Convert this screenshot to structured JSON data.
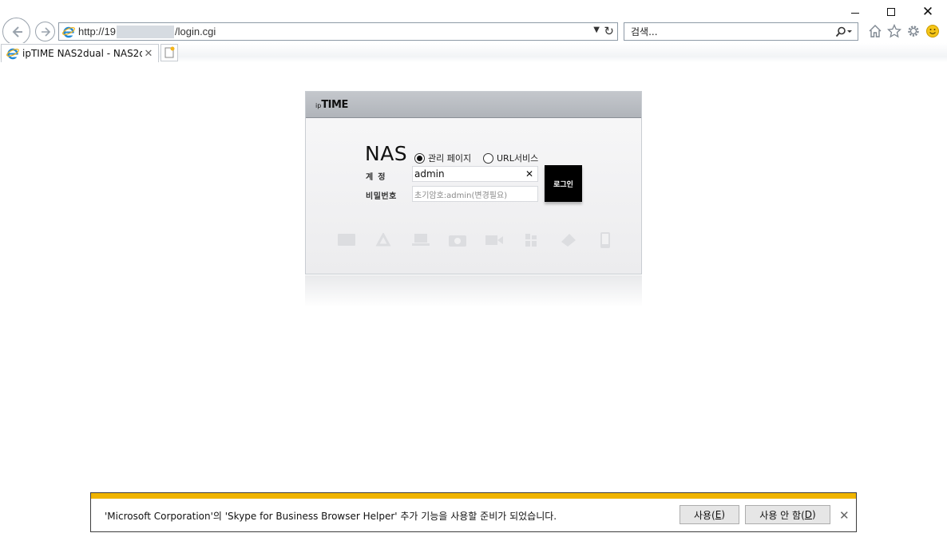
{
  "browser": {
    "address_prefix": "http://19",
    "address_suffix": "/login.cgi",
    "search_placeholder": "검색...",
    "tab_title": "ipTIME NAS2dual - NAS2d...",
    "window_controls": {
      "minimize": "minimize-icon",
      "maximize": "maximize-icon",
      "close": "close-icon"
    },
    "toolbar_icons": [
      "home-icon",
      "star-icon",
      "gear-icon",
      "smile-icon"
    ]
  },
  "login": {
    "brand_prefix": "ip",
    "brand_name": "TIME",
    "title": "NAS",
    "radio_admin": "관리 페이지",
    "radio_url": "URL서비스",
    "selected_mode": "관리 페이지",
    "label_account": "계정",
    "label_password": "비밀번호",
    "account_value": "admin",
    "password_placeholder": "초기암호:admin(변경필요)",
    "login_button": "로그인",
    "feature_icons": [
      "monitor-icon",
      "recycle-icon",
      "laptop-icon",
      "camera-icon",
      "video-icon",
      "apps-icon",
      "memory-card-icon",
      "phone-icon"
    ]
  },
  "notification": {
    "message": "'Microsoft Corporation'의 'Skype for Business Browser Helper' 추가 기능을 사용할 준비가 되었습니다.",
    "allow_label": "사용(",
    "allow_key": "E",
    "allow_end": ")",
    "deny_label": "사용 안 함(",
    "deny_key": "D",
    "deny_end": ")",
    "stripe_color": "#f0b400"
  }
}
